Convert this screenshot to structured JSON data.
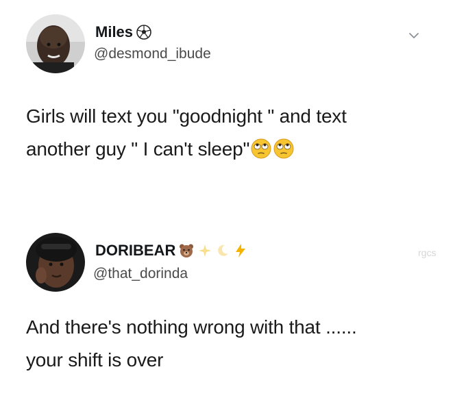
{
  "tweets": [
    {
      "display_name": "Miles",
      "name_emoji": "soccer-ball-icon",
      "handle": "@desmond_ibude",
      "text_lines": [
        "Girls will text you \"goodnight \" and text",
        "another guy \" I can't sleep\""
      ],
      "text_emojis": [
        "face-with-rolling-eyes-icon",
        "face-with-rolling-eyes-icon"
      ]
    },
    {
      "display_name": "DORIBEAR",
      "name_emojis": [
        "bear-icon",
        "sparkle-icon",
        "crescent-moon-icon",
        "lightning-bolt-icon"
      ],
      "handle": "@that_dorinda",
      "text_lines": [
        "And there's nothing wrong with that ......",
        "your shift is over"
      ]
    }
  ],
  "watermark": "rgcs",
  "colors": {
    "text": "#1a1a1a",
    "handle": "#4a4a4a",
    "background": "#ffffff"
  }
}
